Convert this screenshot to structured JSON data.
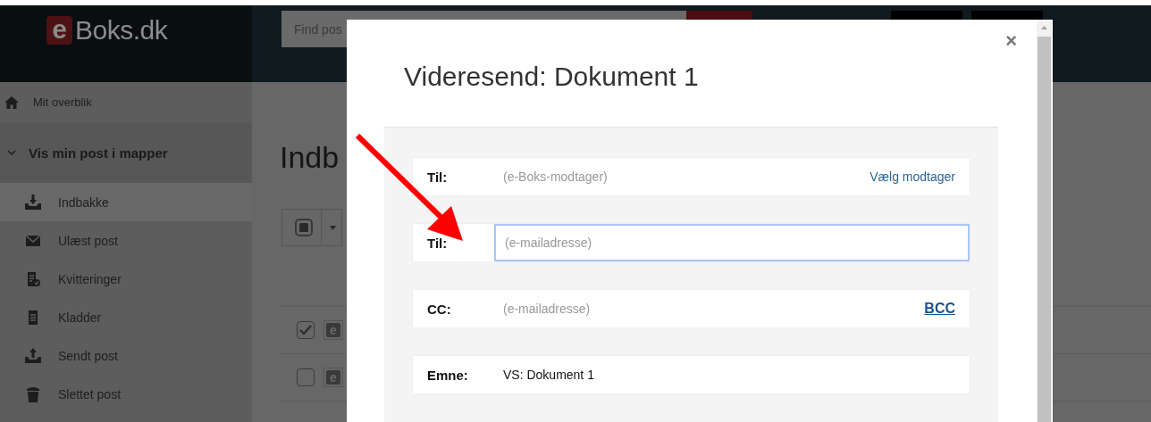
{
  "header": {
    "logo_badge": "e",
    "logo_text": "Boks.dk",
    "search": {
      "placeholder": "Find pos"
    }
  },
  "sidebar": {
    "overview": "Mit overblik",
    "section": {
      "label": "Vis min post i mapper",
      "expanded": true
    },
    "items": [
      {
        "label": "Indbakke",
        "kind": "inbox",
        "selected": true
      },
      {
        "label": "Ulæst post",
        "kind": "unread",
        "selected": false
      },
      {
        "label": "Kvitteringer",
        "kind": "receipts",
        "selected": false
      },
      {
        "label": "Kladder",
        "kind": "drafts",
        "selected": false
      },
      {
        "label": "Sendt post",
        "kind": "sent",
        "selected": false
      },
      {
        "label": "Slettet post",
        "kind": "deleted",
        "selected": false
      }
    ]
  },
  "main": {
    "title": "Indb",
    "rows": [
      {
        "checked": true,
        "badge": "e"
      },
      {
        "checked": false,
        "badge": "e"
      }
    ]
  },
  "dialog": {
    "title": "Videresend: Dokument 1",
    "close": "×",
    "fields": [
      {
        "label": "Til:",
        "placeholder": "(e-Boks-modtager)",
        "focused": false,
        "action": {
          "label": "Vælg modtager",
          "underlined": false
        }
      },
      {
        "label": "Til:",
        "placeholder": "(e-mailadresse)",
        "focused": true
      },
      {
        "label": "CC:",
        "placeholder": "(e-mailadresse)",
        "focused": false,
        "action": {
          "label": "BCC",
          "underlined": true
        }
      },
      {
        "label": "Emne:",
        "value": "VS: Dokument 1",
        "focused": false
      }
    ]
  }
}
